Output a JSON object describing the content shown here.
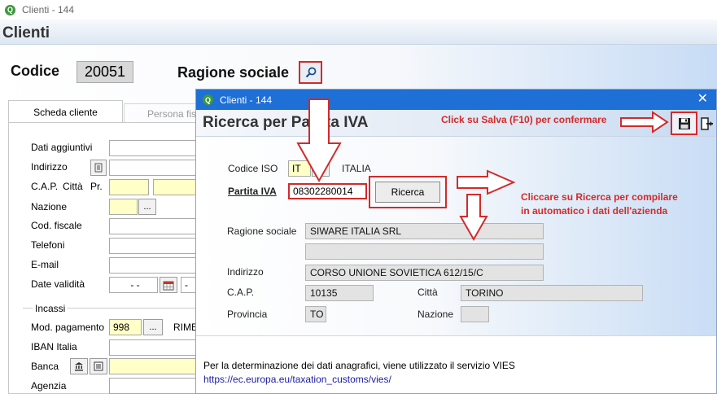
{
  "main": {
    "window_title": "Clienti - 144",
    "title": "Clienti",
    "codice_label": "Codice",
    "codice_value": "20051",
    "ragione_sociale_label": "Ragione sociale",
    "tabs": [
      {
        "label": "Scheda cliente"
      },
      {
        "label": "Persona fisica"
      }
    ],
    "fields": {
      "dati_aggiuntivi": "Dati aggiuntivi",
      "indirizzo": "Indirizzo",
      "cap": "C.A.P.",
      "citta": "Città",
      "pr": "Pr.",
      "nazione": "Nazione",
      "cod_fiscale": "Cod. fiscale",
      "telefoni": "Telefoni",
      "email": "E-mail",
      "date_validita": "Date validità",
      "date_from_value": "- -",
      "date_to_value": "-"
    },
    "incassi": {
      "group_label": "Incassi",
      "mod_pagamento_label": "Mod. pagamento",
      "mod_pagamento_value": "998",
      "rimessa_label": "RIMESSA",
      "iban_label": "IBAN Italia",
      "banca_label": "Banca",
      "agenzia_label": "Agenzia"
    },
    "browse_button": "..."
  },
  "dialog": {
    "window_title": "Clienti - 144",
    "title": "Ricerca per Partita IVA",
    "codice_iso_label": "Codice ISO",
    "codice_iso_value": "IT",
    "country_name": "ITALIA",
    "partita_iva_label": "Partita IVA",
    "partita_iva_value": "08302280014",
    "ricerca_button": "Ricerca",
    "ragione_sociale_label": "Ragione sociale",
    "ragione_sociale_value": "SIWARE ITALIA SRL",
    "ragione_sociale_value2": "",
    "indirizzo_label": "Indirizzo",
    "indirizzo_value": "CORSO UNIONE SOVIETICA 612/15/C",
    "cap_label": "C.A.P.",
    "cap_value": "10135",
    "citta_label": "Città",
    "citta_value": "TORINO",
    "provincia_label": "Provincia",
    "provincia_value": "TO",
    "nazione_label": "Nazione",
    "nazione_value": "",
    "footer_text": "Per la determinazione dei dati anagrafici, viene utilizzato il servizio VIES",
    "footer_link": "https://ec.europa.eu/taxation_customs/vies/"
  },
  "annotations": {
    "save_hint": "Click su Salva (F10) per confermare",
    "ricerca_hint_line1": "Cliccare su Ricerca per compilare",
    "ricerca_hint_line2": "in automatico i dati dell'azienda"
  },
  "colors": {
    "annotation_red": "#d32a2a",
    "titlebar_blue": "#1e6fd6",
    "field_yellow": "#ffffc8",
    "link_blue": "#1a1aa6"
  }
}
